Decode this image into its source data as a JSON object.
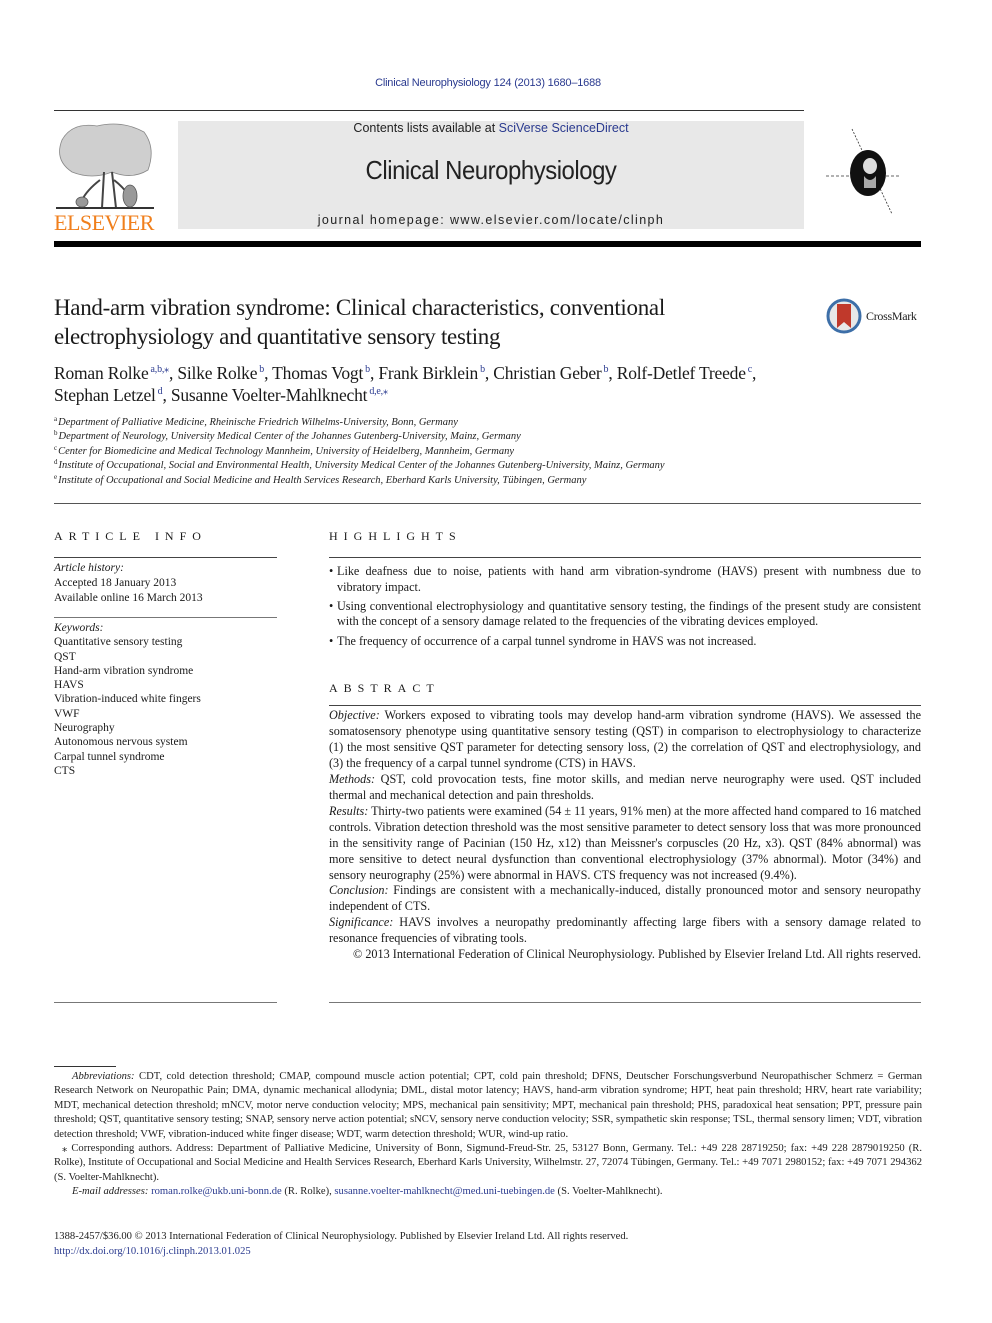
{
  "header": {
    "journal_ref": "Clinical Neurophysiology 124 (2013) 1680–1688",
    "contents_prefix": "Contents lists available at ",
    "contents_link": "SciVerse ScienceDirect",
    "journal_title": "Clinical Neurophysiology",
    "homepage_prefix": "journal homepage: ",
    "homepage_url": "www.elsevier.com/locate/clinph",
    "publisher_wordmark": "ELSEVIER",
    "publisher_color": "#f07f1c",
    "link_color": "#2a3a8f"
  },
  "article": {
    "title": "Hand-arm vibration syndrome: Clinical characteristics, conventional electrophysiology and quantitative sensory testing",
    "crossmark_label": "CrossMark",
    "authors": [
      {
        "name": "Roman Rolke",
        "sup": "a,b,⁎",
        "sep": ", "
      },
      {
        "name": "Silke Rolke",
        "sup": "b",
        "sep": ", "
      },
      {
        "name": "Thomas Vogt",
        "sup": "b",
        "sep": ", "
      },
      {
        "name": "Frank Birklein",
        "sup": "b",
        "sep": ", "
      },
      {
        "name": "Christian Geber",
        "sup": "b",
        "sep": ", "
      },
      {
        "name": "Rolf-Detlef Treede",
        "sup": "c",
        "sep": ","
      },
      {
        "name": "Stephan Letzel",
        "sup": "d",
        "sep": ", "
      },
      {
        "name": "Susanne Voelter-Mahlknecht",
        "sup": "d,e,⁎",
        "sep": ""
      }
    ],
    "affiliations": [
      {
        "key": "a",
        "text": "Department of Palliative Medicine, Rheinische Friedrich Wilhelms-University, Bonn, Germany"
      },
      {
        "key": "b",
        "text": "Department of Neurology, University Medical Center of the Johannes Gutenberg-University, Mainz, Germany"
      },
      {
        "key": "c",
        "text": "Center for Biomedicine and Medical Technology Mannheim, University of Heidelberg, Mannheim, Germany"
      },
      {
        "key": "d",
        "text": "Institute of Occupational, Social and Environmental Health, University Medical Center of the Johannes Gutenberg-University, Mainz, Germany"
      },
      {
        "key": "e",
        "text": "Institute of Occupational and Social Medicine and Health Services Research, Eberhard Karls University, Tübingen, Germany"
      }
    ]
  },
  "article_info": {
    "heading": "ARTICLE INFO",
    "history_label": "Article history:",
    "history": [
      "Accepted 18 January 2013",
      "Available online 16 March 2013"
    ],
    "keywords_label": "Keywords:",
    "keywords": [
      "Quantitative sensory testing",
      "QST",
      "Hand-arm vibration syndrome",
      "HAVS",
      "Vibration-induced white fingers",
      "VWF",
      "Neurography",
      "Autonomous nervous system",
      "Carpal tunnel syndrome",
      "CTS"
    ]
  },
  "highlights": {
    "heading": "HIGHLIGHTS",
    "bullet": "•",
    "items": [
      " Like deafness due to noise, patients with hand arm vibration-syndrome (HAVS) present with numbness due to vibratory impact.",
      "Using conventional electrophysiology and quantitative sensory testing, the findings of the present study are consistent with the concept of a sensory damage related to the frequencies of the vibrating devices employed.",
      " The frequency of occurrence of a carpal tunnel syndrome in HAVS was not increased."
    ]
  },
  "abstract": {
    "heading": "ABSTRACT",
    "sections": [
      {
        "label": "Objective:",
        "text": " Workers exposed to vibrating tools may develop hand-arm vibration syndrome (HAVS). We assessed the somatosensory phenotype using quantitative sensory testing (QST) in comparison to electrophysiology to characterize (1) the most sensitive QST parameter for detecting sensory loss, (2) the correlation of QST and electrophysiology, and (3) the frequency of a carpal tunnel syndrome (CTS) in HAVS."
      },
      {
        "label": "Methods:",
        "text": " QST, cold provocation tests, fine motor skills, and median nerve neurography were used. QST included thermal and mechanical detection and pain thresholds."
      },
      {
        "label": "Results:",
        "text": " Thirty-two patients were examined (54 ± 11 years, 91% men) at the more affected hand compared to 16 matched controls. Vibration detection threshold was the most sensitive parameter to detect sensory loss that was more pronounced in the sensitivity range of Pacinian (150 Hz, x12) than Meissner's corpuscles (20 Hz, x3). QST (84% abnormal) was more sensitive to detect neural dysfunction than conventional electrophysiology (37% abnormal). Motor (34%) and sensory neurography (25%) were abnormal in HAVS. CTS frequency was not increased (9.4%)."
      },
      {
        "label": "Conclusion:",
        "text": " Findings are consistent with a mechanically-induced, distally pronounced motor and sensory neuropathy independent of CTS."
      },
      {
        "label": "Significance:",
        "text": " HAVS involves a neuropathy predominantly affecting large fibers with a sensory damage related to resonance frequencies of vibrating tools."
      }
    ],
    "copyright": "© 2013 International Federation of Clinical Neurophysiology. Published by Elsevier Ireland Ltd. All rights reserved."
  },
  "footnotes": {
    "abbreviations_label": "Abbreviations:",
    "abbreviations_text": " CDT, cold detection threshold; CMAP, compound muscle action potential; CPT, cold pain threshold; DFNS, Deutscher Forschungsverbund Neuropathischer Schmerz = German Research Network on Neuropathic Pain; DMA, dynamic mechanical allodynia; DML, distal motor latency; HAVS, hand-arm vibration syndrome; HPT, heat pain threshold; HRV, heart rate variability; MDT, mechanical detection threshold; mNCV, motor nerve conduction velocity; MPS, mechanical pain sensitivity; MPT, mechanical pain threshold; PHS, paradoxical heat sensation; PPT, pressure pain threshold; QST, quantitative sensory testing; SNAP, sensory nerve action potential; sNCV, sensory nerve conduction velocity; SSR, sympathetic skin response; TSL, thermal sensory limen; VDT, vibration detection threshold; VWF, vibration-induced white finger disease; WDT, warm detection threshold; WUR, wind-up ratio.",
    "corresponding": "⁎ Corresponding authors. Address: Department of Palliative Medicine, University of Bonn, Sigmund-Freud-Str. 25, 53127 Bonn, Germany. Tel.: +49 228 28719250; fax: +49 228 2879019250 (R. Rolke), Institute of Occupational and Social Medicine and Health Services Research, Eberhard Karls University, Wilhelmstr. 27, 72074 Tübingen, Germany. Tel.: +49 7071 2980152; fax: +49 7071 294362 (S. Voelter-Mahlknecht).",
    "email_label": "E-mail addresses:",
    "email_1": "roman.rolke@ukb.uni-bonn.de",
    "email_1_owner": " (R. Rolke), ",
    "email_2": "susanne.voelter-mahlknecht@med.uni-tuebingen.de",
    "email_2_owner": " (S. Voelter-Mahlknecht)."
  },
  "issn": {
    "line": "1388-2457/$36.00 © 2013 International Federation of Clinical Neurophysiology. Published by Elsevier Ireland Ltd. All rights reserved.",
    "doi": "http://dx.doi.org/10.1016/j.clinph.2013.01.025"
  }
}
